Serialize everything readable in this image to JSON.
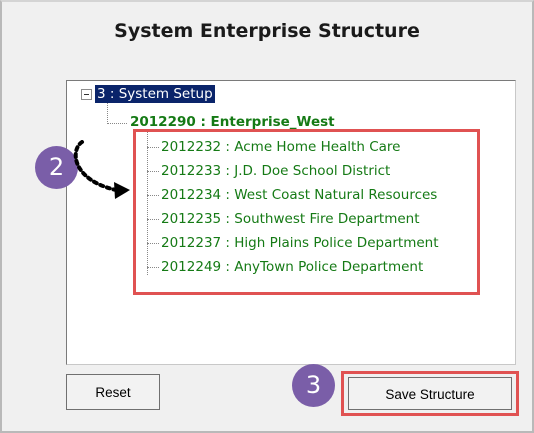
{
  "title": "System Enterprise Structure",
  "tree": {
    "root_label": "3 : System Setup",
    "enterprise_label": "2012290 : Enterprise_West",
    "children": [
      "2012232 : Acme Home Health Care",
      "2012233 : J.D. Doe School District",
      "2012234 : West Coast Natural Resources",
      "2012235 : Southwest Fire Department",
      "2012237 : High Plains Police Department",
      "2012249 : AnyTown Police Department"
    ]
  },
  "callouts": {
    "step2": "2",
    "step3": "3"
  },
  "buttons": {
    "reset_label": "Reset",
    "save_label": "Save Structure"
  },
  "colors": {
    "selection": "#0a246a",
    "node_text": "#157a15",
    "callout_badge": "#7a5ea8",
    "highlight_border": "#e05252"
  }
}
